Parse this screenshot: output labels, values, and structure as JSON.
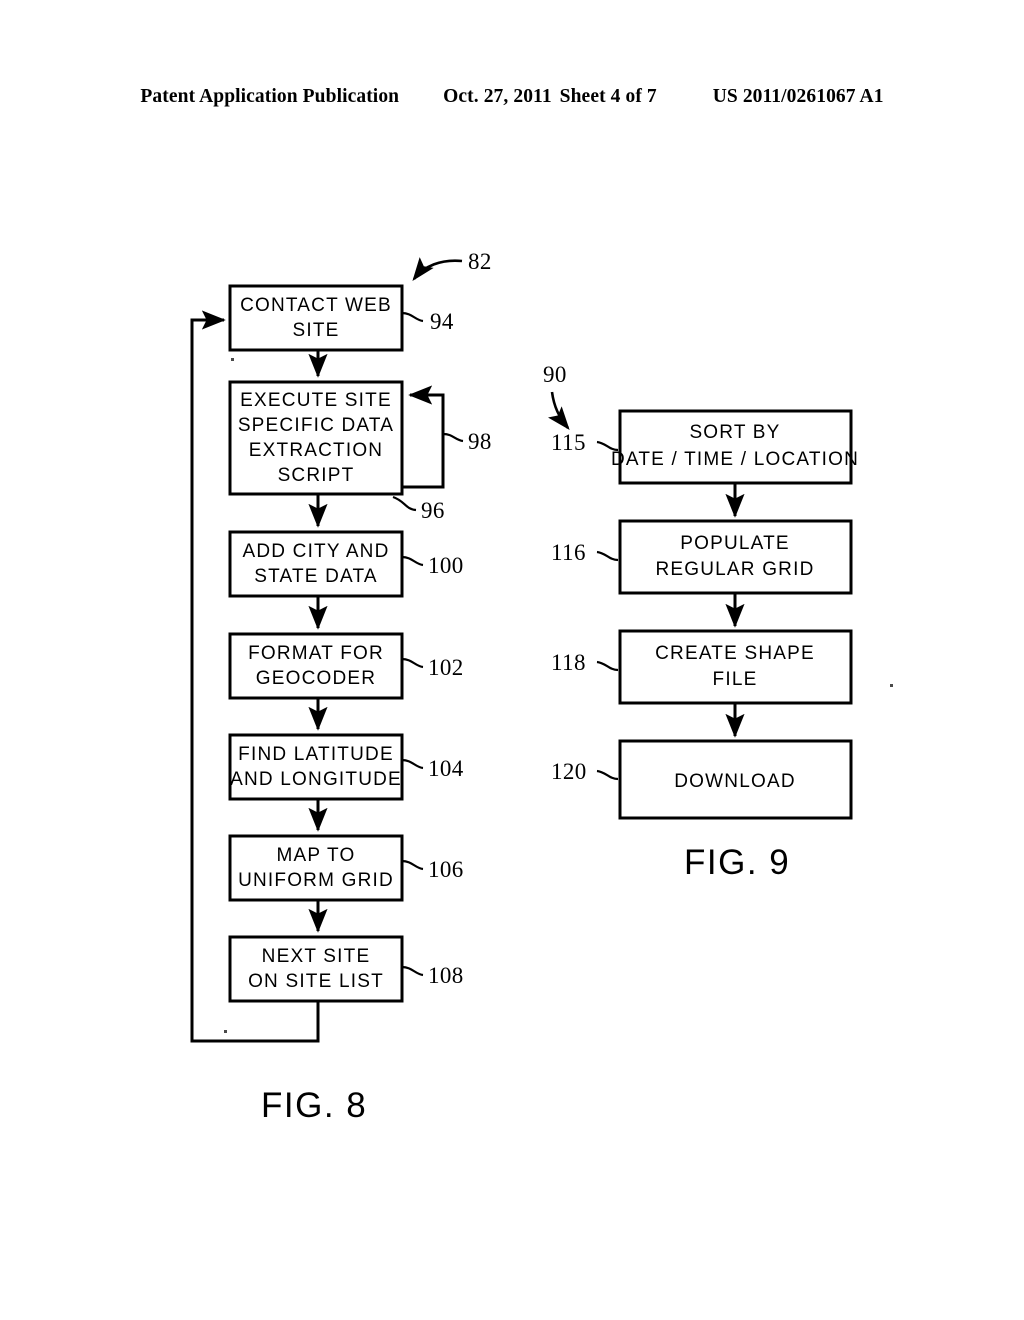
{
  "header": {
    "publication": "Patent Application Publication",
    "date": "Oct. 27, 2011",
    "sheet": "Sheet 4 of 7",
    "patent_number": "US 2011/0261067 A1"
  },
  "figures": [
    {
      "id": "fig8",
      "label": "FIG. 8",
      "reference": "82",
      "steps": [
        {
          "ref": "94",
          "lines": [
            "CONTACT  WEB",
            "SITE"
          ]
        },
        {
          "ref": "96",
          "lines": [
            "EXECUTE  SITE",
            "SPECIFIC  DATA",
            "EXTRACTION",
            "SCRIPT"
          ],
          "loop_ref": "98"
        },
        {
          "ref": "100",
          "lines": [
            "ADD  CITY AND",
            "STATE  DATA"
          ]
        },
        {
          "ref": "102",
          "lines": [
            "FORMAT FOR",
            "GEOCODER"
          ]
        },
        {
          "ref": "104",
          "lines": [
            "FIND  LATITUDE",
            "AND  LONGITUDE"
          ]
        },
        {
          "ref": "106",
          "lines": [
            "MAP  TO",
            "UNIFORM  GRID"
          ]
        },
        {
          "ref": "108",
          "lines": [
            "NEXT  SITE",
            "ON  SITE  LIST"
          ]
        }
      ]
    },
    {
      "id": "fig9",
      "label": "FIG. 9",
      "reference": "90",
      "steps": [
        {
          "ref": "115",
          "lines": [
            "SORT  BY",
            "DATE / TIME / LOCATION"
          ]
        },
        {
          "ref": "116",
          "lines": [
            "POPULATE",
            "REGULAR  GRID"
          ]
        },
        {
          "ref": "118",
          "lines": [
            "CREATE  SHAPE",
            "FILE"
          ]
        },
        {
          "ref": "120",
          "lines": [
            "DOWNLOAD"
          ]
        }
      ]
    }
  ],
  "colors": {
    "ink": "#000000",
    "paper": "#ffffff"
  }
}
